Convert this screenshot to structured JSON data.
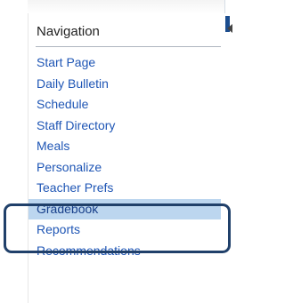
{
  "navigation": {
    "title": "Navigation",
    "items": [
      {
        "label": "Start Page"
      },
      {
        "label": "Daily Bulletin"
      },
      {
        "label": "Schedule"
      },
      {
        "label": "Staff Directory"
      },
      {
        "label": "Meals"
      },
      {
        "label": "Personalize"
      },
      {
        "label": "Teacher Prefs"
      },
      {
        "label": "Gradebook"
      },
      {
        "label": "Reports"
      },
      {
        "label": "Recommendations"
      }
    ],
    "selected_index": 7
  },
  "colors": {
    "link": "#1f56b5",
    "selected_bg": "#bcd6ef",
    "highlight_border": "#20406a"
  }
}
